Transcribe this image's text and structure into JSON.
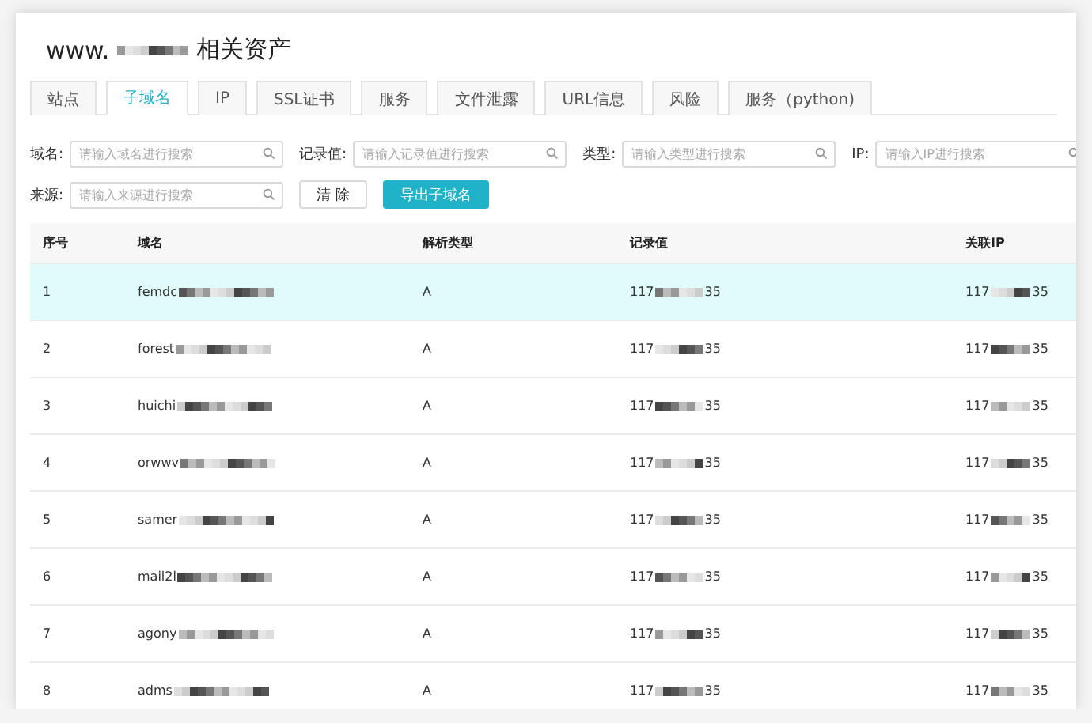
{
  "title": {
    "prefix": "www.",
    "suffix": "相关资产"
  },
  "tabs": [
    {
      "label": "站点",
      "selected": false
    },
    {
      "label": "子域名",
      "selected": true
    },
    {
      "label": "IP",
      "selected": false
    },
    {
      "label": "SSL证书",
      "selected": false
    },
    {
      "label": "服务",
      "selected": false
    },
    {
      "label": "文件泄露",
      "selected": false
    },
    {
      "label": "URL信息",
      "selected": false
    },
    {
      "label": "风险",
      "selected": false
    },
    {
      "label": "服务（python)",
      "selected": false
    }
  ],
  "filters": [
    {
      "label": "域名:",
      "placeholder": "请输入域名进行搜索"
    },
    {
      "label": "记录值:",
      "placeholder": "请输入记录值进行搜索"
    },
    {
      "label": "类型:",
      "placeholder": "请输入类型进行搜索"
    },
    {
      "label": "IP:",
      "placeholder": "请输入IP进行搜索"
    },
    {
      "label": "来源:",
      "placeholder": "请输入来源进行搜索"
    }
  ],
  "buttons": [
    {
      "label": "清 除",
      "kind": "plain"
    },
    {
      "label": "导出子域名",
      "kind": "primary"
    }
  ],
  "table": {
    "columns": [
      "序号",
      "域名",
      "解析类型",
      "记录值",
      "关联IP"
    ],
    "rows": [
      {
        "selected": true,
        "cells": [
          "1",
          "femdc",
          "A",
          {
            "start": "117",
            "end": "35"
          },
          {
            "start": "117",
            "end": "35"
          }
        ]
      },
      {
        "selected": false,
        "cells": [
          "2",
          "forest",
          "A",
          {
            "start": "117",
            "end": "35"
          },
          {
            "start": "117",
            "end": "35"
          }
        ]
      },
      {
        "selected": false,
        "cells": [
          "3",
          "huichi",
          "A",
          {
            "start": "117",
            "end": "35"
          },
          {
            "start": "117",
            "end": "35"
          }
        ]
      },
      {
        "selected": false,
        "cells": [
          "4",
          "orwwv",
          "A",
          {
            "start": "117",
            "end": "35"
          },
          {
            "start": "117",
            "end": "35"
          }
        ]
      },
      {
        "selected": false,
        "cells": [
          "5",
          "samer",
          "A",
          {
            "start": "117",
            "end": "35"
          },
          {
            "start": "117",
            "end": "35"
          }
        ]
      },
      {
        "selected": false,
        "cells": [
          "6",
          "mail2l",
          "A",
          {
            "start": "117",
            "end": "35"
          },
          {
            "start": "117",
            "end": "35"
          }
        ]
      },
      {
        "selected": false,
        "cells": [
          "7",
          "agony",
          "A",
          {
            "start": "117",
            "end": "35"
          },
          {
            "start": "117",
            "end": "35"
          }
        ]
      },
      {
        "selected": false,
        "cells": [
          "8",
          "adms",
          "A",
          {
            "start": "117",
            "end": "35"
          },
          {
            "start": "117",
            "end": "35"
          }
        ]
      }
    ]
  }
}
